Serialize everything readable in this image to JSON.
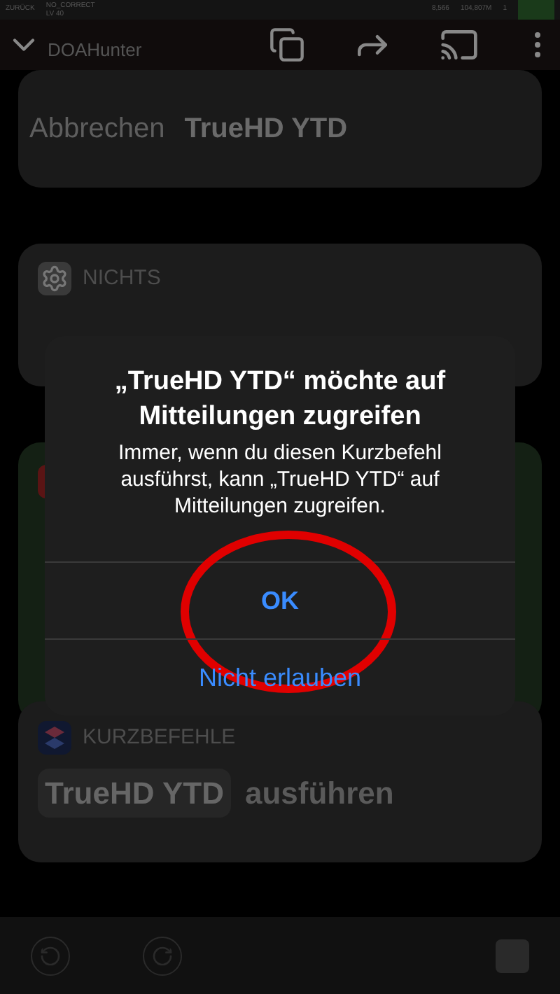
{
  "game_bar": {
    "back": "ZURÜCK",
    "player": "NO_CORRECT",
    "level_label": "LV 40",
    "coins": "8,566",
    "gold": "104,807M",
    "gems": "1"
  },
  "video_bar": {
    "channel": "DOAHunter"
  },
  "sheet": {
    "cancel": "Abbrechen",
    "title": "TrueHD YTD"
  },
  "cards": [
    {
      "kind": "action",
      "app": "NICHTS"
    },
    {
      "kind": "hidden"
    },
    {
      "kind": "shortcut",
      "app": "KURZBEFEHLE",
      "token": "TrueHD YTD",
      "text": "ausführen"
    }
  ],
  "dialog": {
    "title": "„TrueHD YTD“ möchte auf Mitteilungen zugreifen",
    "message": "Immer, wenn du diesen Kurzbefehl ausführst, kann „TrueHD YTD“ auf Mitteilungen zugreifen.",
    "buttons": [
      {
        "label": "OK",
        "circled": true
      },
      {
        "label": "Nicht erlauben",
        "circled": false
      }
    ]
  }
}
